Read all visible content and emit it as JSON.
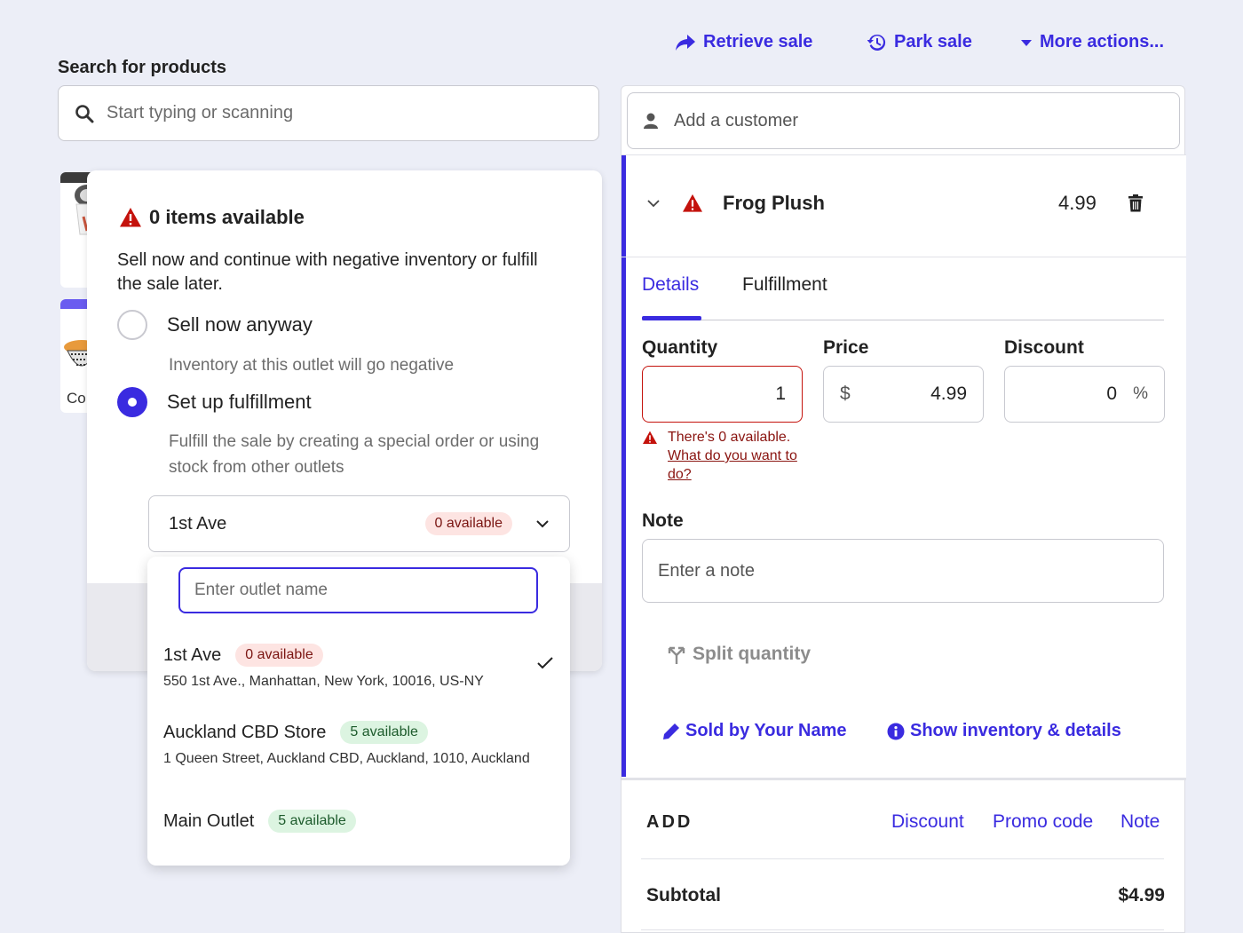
{
  "header": {
    "retrieve_sale": "Retrieve sale",
    "park_sale": "Park sale",
    "more_actions": "More actions..."
  },
  "search": {
    "label": "Search for products",
    "placeholder": "Start typing or scanning"
  },
  "tiles": {
    "second_label": "Co"
  },
  "popover": {
    "title": "0 items available",
    "description": "Sell now and continue with negative inventory or fulfill the sale later.",
    "options": [
      {
        "label": "Sell now anyway",
        "hint": "Inventory at this outlet will go negative",
        "selected": false
      },
      {
        "label": "Set up fulfillment",
        "hint": "Fulfill the sale by creating a special order or using stock from other outlets",
        "selected": true
      }
    ],
    "selected_outlet": {
      "name": "1st Ave",
      "badge": "0 available"
    }
  },
  "dropdown": {
    "placeholder": "Enter outlet name",
    "items": [
      {
        "name": "1st Ave",
        "badge": "0 available",
        "badge_status": "red",
        "address": "550 1st Ave., Manhattan, New York, 10016, US-NY",
        "checked": true
      },
      {
        "name": "Auckland CBD Store",
        "badge": "5 available",
        "badge_status": "green",
        "address": "1 Queen Street, Auckland CBD, Auckland, 1010, Auckland",
        "checked": false
      },
      {
        "name": "Main Outlet",
        "badge": "5 available",
        "badge_status": "green",
        "address": "",
        "checked": false
      }
    ]
  },
  "panel": {
    "customer_placeholder": "Add a customer",
    "line_item": {
      "name": "Frog Plush",
      "price": "4.99"
    },
    "tabs": [
      {
        "label": "Details",
        "active": true
      },
      {
        "label": "Fulfillment",
        "active": false
      }
    ],
    "quantity": {
      "label": "Quantity",
      "value": "1"
    },
    "price": {
      "label": "Price",
      "currency": "$",
      "value": "4.99"
    },
    "discount": {
      "label": "Discount",
      "value": "0",
      "unit": "%"
    },
    "error": {
      "message": "There's 0 available.",
      "link": "What do you want to do?"
    },
    "note": {
      "label": "Note",
      "placeholder": "Enter a note"
    },
    "split_quantity": "Split quantity",
    "sold_by": "Sold by Your Name",
    "show_inventory": "Show inventory & details",
    "add": {
      "label": "ADD",
      "discount": "Discount",
      "promo_code": "Promo code",
      "note": "Note"
    },
    "subtotal": {
      "label": "Subtotal",
      "value": "$4.99"
    }
  },
  "colors": {
    "accent": "#3a2be0",
    "error": "#c4120c",
    "badge_red_bg": "#fde4e2",
    "badge_green_bg": "#dcf4e1"
  }
}
